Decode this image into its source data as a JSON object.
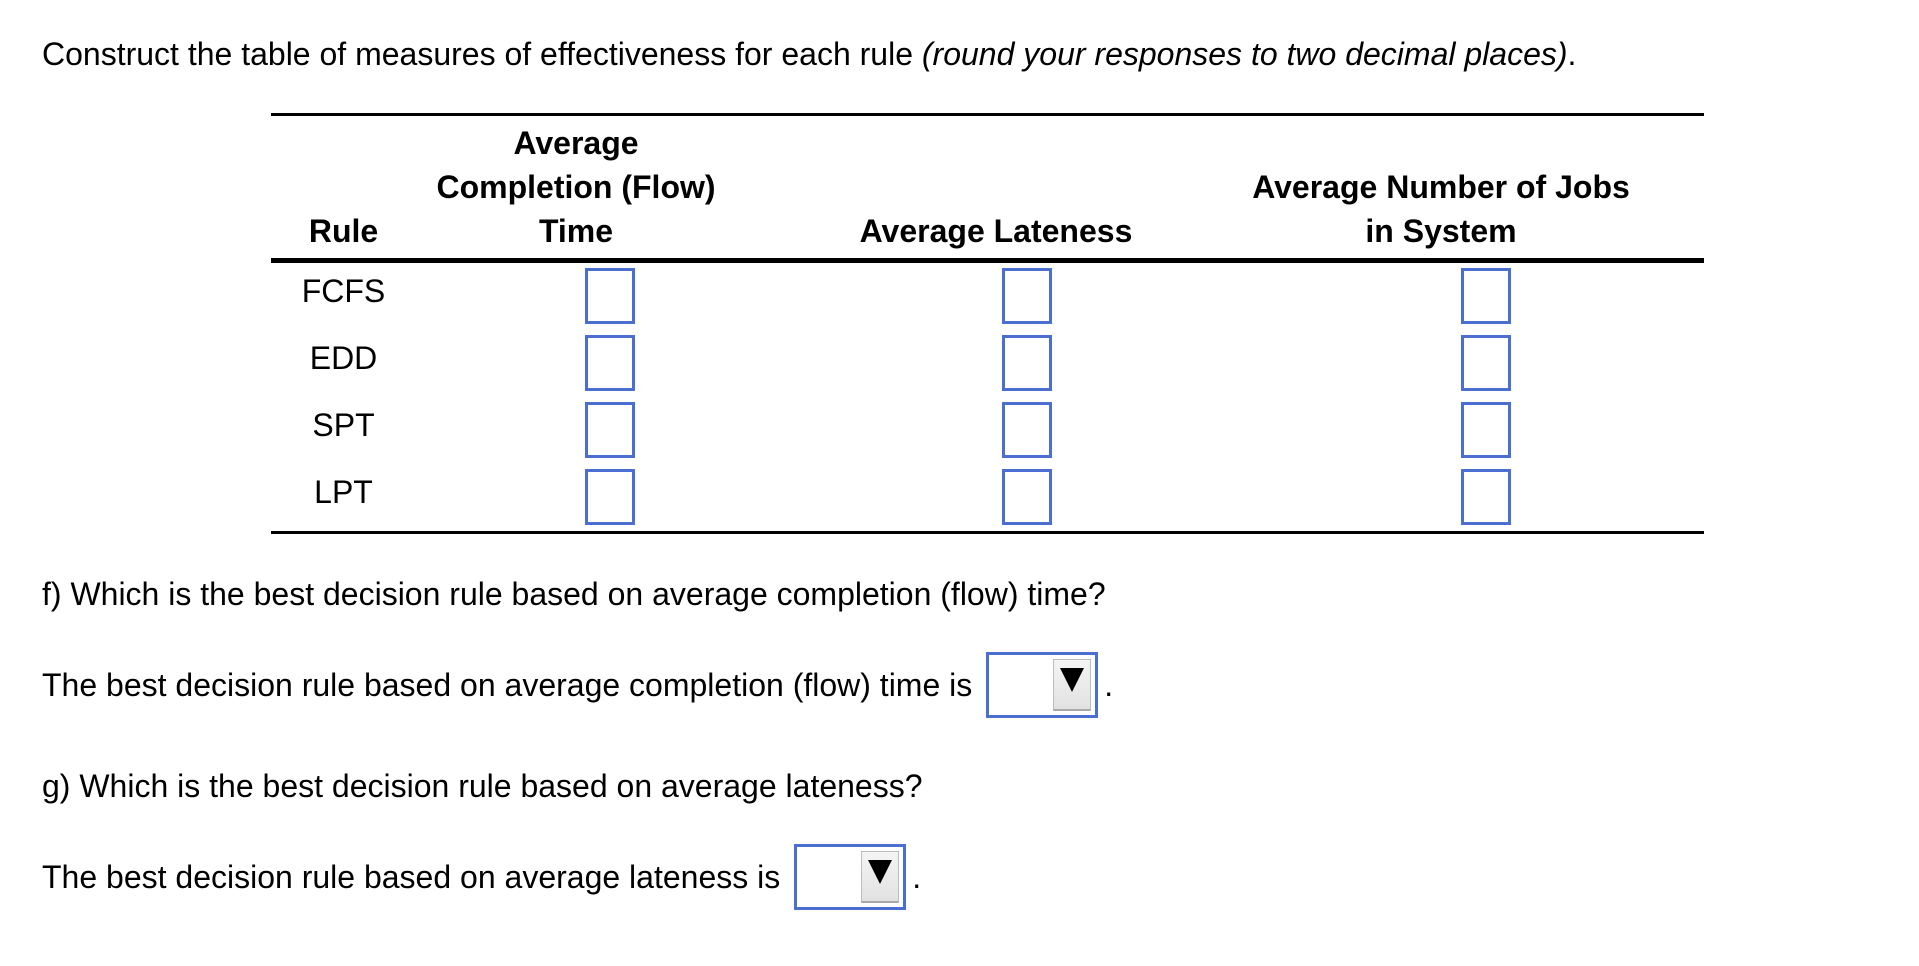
{
  "instruction": {
    "text": "Construct the table of measures of effectiveness for each rule ",
    "note": "(round your responses to two decimal places)",
    "end": "."
  },
  "table": {
    "headers": {
      "rule": "Rule",
      "col1": [
        "Average",
        "Completion (Flow)",
        "Time"
      ],
      "col2": "Average Lateness",
      "col3": [
        "Average Number of Jobs",
        "in System"
      ]
    },
    "rows": [
      {
        "rule": "FCFS",
        "flow_time": "",
        "lateness": "",
        "jobs_in_system": ""
      },
      {
        "rule": "EDD",
        "flow_time": "",
        "lateness": "",
        "jobs_in_system": ""
      },
      {
        "rule": "SPT",
        "flow_time": "",
        "lateness": "",
        "jobs_in_system": ""
      },
      {
        "rule": "LPT",
        "flow_time": "",
        "lateness": "",
        "jobs_in_system": ""
      }
    ]
  },
  "question_f": {
    "prompt": "f) Which is the best decision rule based on average completion (flow) time?",
    "answer_text": "The best decision rule based on average completion (flow) time is",
    "selected": "",
    "end": "."
  },
  "question_g": {
    "prompt": "g) Which is the best decision rule based on average lateness?",
    "answer_text": "The best decision rule based on average lateness is",
    "selected": "",
    "end": "."
  },
  "colors": {
    "input_border": "#4a6fd1",
    "text": "#000000"
  }
}
